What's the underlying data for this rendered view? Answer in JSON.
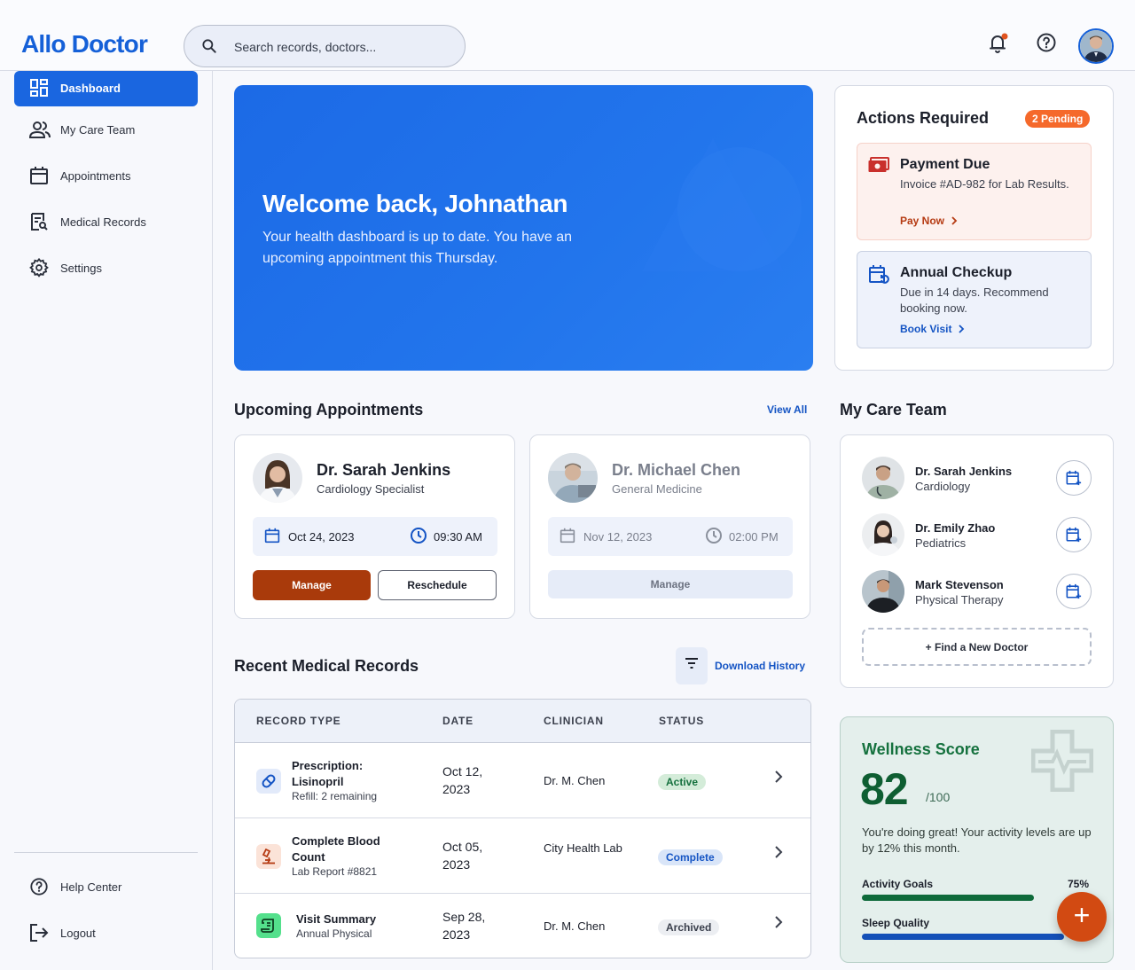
{
  "app": {
    "logo": "Allo Doctor"
  },
  "header": {
    "search_placeholder": "Search records, doctors...",
    "icons": {
      "search": "search-icon",
      "notifications": "bell-icon",
      "help": "help-icon",
      "avatar": "user-avatar"
    },
    "notification_dot_color": "#e0531f"
  },
  "sidebar": {
    "items": [
      {
        "label": "Dashboard",
        "icon": "dashboard-icon",
        "active": true
      },
      {
        "label": "My Care Team",
        "icon": "people-icon"
      },
      {
        "label": "Appointments",
        "icon": "calendar-icon"
      },
      {
        "label": "Medical Records",
        "icon": "records-icon"
      },
      {
        "label": "Settings",
        "icon": "gear-icon"
      }
    ],
    "footer": [
      {
        "label": "Help Center",
        "icon": "help-icon"
      },
      {
        "label": "Logout",
        "icon": "logout-icon"
      }
    ]
  },
  "hero": {
    "title": "Welcome back, Johnathan",
    "subtitle": "Your health dashboard is up to date. You have an upcoming appointment this Thursday."
  },
  "actions": {
    "title": "Actions Required",
    "badge": "2 Pending",
    "items": [
      {
        "title": "Payment Due",
        "desc": "Invoice #AD-982 for Lab Results.",
        "link": "Pay Now",
        "icon": "payment-icon"
      },
      {
        "title": "Annual Checkup",
        "desc": "Due in 14 days. Recommend booking now.",
        "link": "Book Visit",
        "icon": "calendar-refresh-icon"
      }
    ]
  },
  "appointments": {
    "title": "Upcoming Appointments",
    "view_all": "View All",
    "items": [
      {
        "name": "Dr. Sarah Jenkins",
        "specialty": "Cardiology Specialist",
        "date": "Oct 24, 2023",
        "time": "09:30 AM",
        "primary": "Manage",
        "secondary": "Reschedule"
      },
      {
        "name": "Dr. Michael Chen",
        "specialty": "General Medicine",
        "date": "Nov 12, 2023",
        "time": "02:00 PM",
        "primary": "Manage"
      }
    ]
  },
  "care_team": {
    "title": "My Care Team",
    "doctors": [
      {
        "name": "Dr. Sarah Jenkins",
        "specialty": "Cardiology"
      },
      {
        "name": "Dr. Emily Zhao",
        "specialty": "Pediatrics"
      },
      {
        "name": "Mark Stevenson",
        "specialty": "Physical Therapy"
      }
    ],
    "find_label": "+ Find a New Doctor"
  },
  "records": {
    "title": "Recent Medical Records",
    "download_label": "Download History",
    "columns": [
      "RECORD TYPE",
      "DATE",
      "CLINICIAN",
      "STATUS"
    ],
    "rows": [
      {
        "title": "Prescription: Lisinopril",
        "sub": "Refill: 2 remaining",
        "date": "Oct 12, 2023",
        "clinician": "Dr. M. Chen",
        "status": "Active",
        "icon": "pill-icon"
      },
      {
        "title": "Complete Blood Count",
        "sub": "Lab Report #8821",
        "date": "Oct 05, 2023",
        "clinician": "City Health Lab",
        "status": "Complete",
        "icon": "microscope-icon"
      },
      {
        "title": "Visit Summary",
        "sub": "Annual Physical",
        "date": "Sep 28, 2023",
        "clinician": "Dr. M. Chen",
        "status": "Archived",
        "icon": "document-icon"
      }
    ]
  },
  "wellness": {
    "title": "Wellness Score",
    "score": "82",
    "max": "/100",
    "desc": "You're doing great! Your activity levels are up by 12% this month.",
    "bars": [
      {
        "label": "Activity Goals",
        "value_label": "75%",
        "value": 0.75,
        "color": "#0e6a3a"
      },
      {
        "label": "Sleep Quality",
        "value": 0.9,
        "color": "#1450b8"
      }
    ]
  },
  "fab": {
    "label": "+"
  },
  "colors": {
    "primary": "#1a66e0",
    "accent": "#a93a0b",
    "pending": "#f5692b",
    "success": "#15713e"
  }
}
